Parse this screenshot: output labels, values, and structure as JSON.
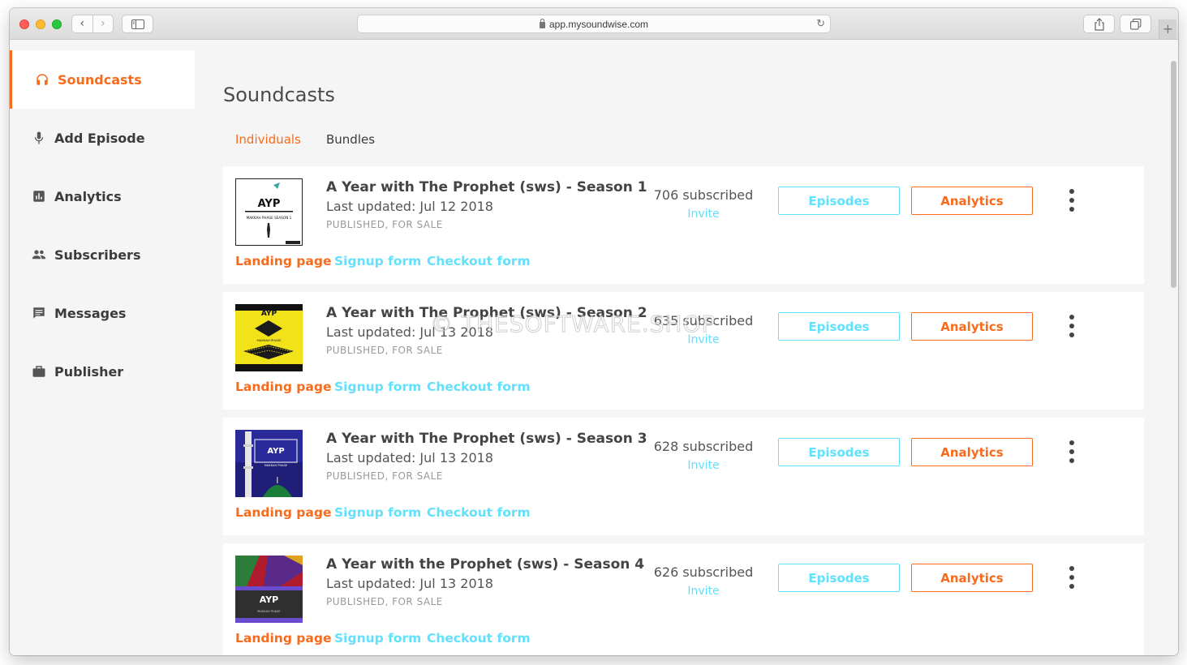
{
  "browser": {
    "url": "app.mysoundwise.com"
  },
  "sidebar": {
    "items": [
      {
        "label": "Soundcasts",
        "icon": "headphones-icon",
        "active": true
      },
      {
        "label": "Add Episode",
        "icon": "microphone-icon",
        "active": false
      },
      {
        "label": "Analytics",
        "icon": "bar-chart-icon",
        "active": false
      },
      {
        "label": "Subscribers",
        "icon": "people-icon",
        "active": false
      },
      {
        "label": "Messages",
        "icon": "message-icon",
        "active": false
      },
      {
        "label": "Publisher",
        "icon": "briefcase-icon",
        "active": false
      }
    ]
  },
  "main": {
    "title": "Soundcasts",
    "tabs": [
      {
        "label": "Individuals",
        "active": true
      },
      {
        "label": "Bundles",
        "active": false
      }
    ],
    "soundcasts": [
      {
        "title": "A Year with The Prophet (sws) - Season 1",
        "updated": "Last updated: Jul 12 2018",
        "status": "PUBLISHED, FOR SALE",
        "subscribed": "706 subscribed",
        "invite": "Invite",
        "episodes_label": "Episodes",
        "analytics_label": "Analytics",
        "landing": "Landing page",
        "signup": "Signup form",
        "checkout": "Checkout form"
      },
      {
        "title": "A Year with The Prophet (sws) - Season 2",
        "updated": "Last updated: Jul 13 2018",
        "status": "PUBLISHED, FOR SALE",
        "subscribed": "635 subscribed",
        "invite": "Invite",
        "episodes_label": "Episodes",
        "analytics_label": "Analytics",
        "landing": "Landing page",
        "signup": "Signup form",
        "checkout": "Checkout form"
      },
      {
        "title": "A Year with The Prophet (sws) - Season 3",
        "updated": "Last updated: Jul 13 2018",
        "status": "PUBLISHED, FOR SALE",
        "subscribed": "628 subscribed",
        "invite": "Invite",
        "episodes_label": "Episodes",
        "analytics_label": "Analytics",
        "landing": "Landing page",
        "signup": "Signup form",
        "checkout": "Checkout form"
      },
      {
        "title": "A Year with the Prophet (sws) - Season 4",
        "updated": "Last updated: Jul 13 2018",
        "status": "PUBLISHED, FOR SALE",
        "subscribed": "626 subscribed",
        "invite": "Invite",
        "episodes_label": "Episodes",
        "analytics_label": "Analytics",
        "landing": "Landing page",
        "signup": "Signup form",
        "checkout": "Checkout form"
      }
    ]
  },
  "covers": [
    {
      "text": "AYP",
      "subtitle": "MAKKAH PHASE SEASON 1"
    },
    {
      "text": "AYP",
      "subtitle": "MAKKAH PHASE"
    },
    {
      "text": "AYP",
      "subtitle": "MAKKAH PHASE"
    },
    {
      "text": "AYP",
      "subtitle": "MAKKAH PHASE"
    }
  ],
  "watermark": "© THESOFTWARE.SHOP",
  "colors": {
    "accent_orange": "#f76b1c",
    "accent_cyan": "#61e1fb",
    "sidebar_bg": "#f5f5f5"
  }
}
